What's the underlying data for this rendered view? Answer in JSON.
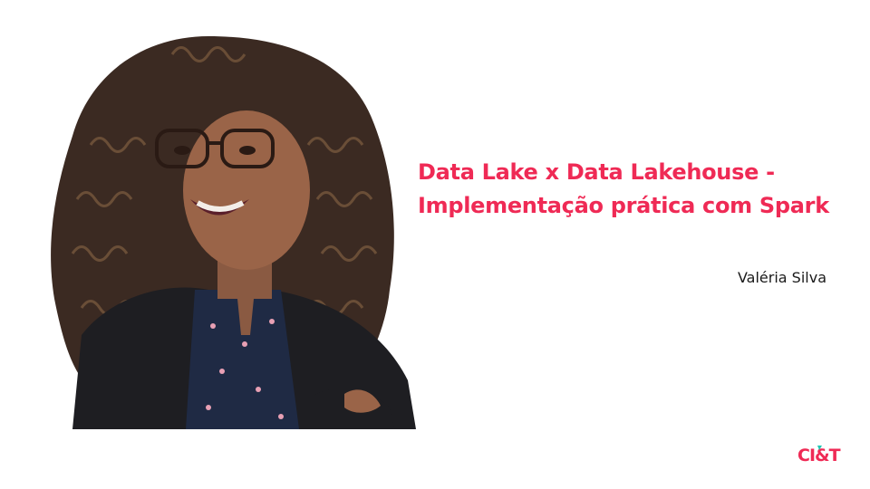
{
  "slide": {
    "title": "Data Lake x Data Lakehouse - Implementação prática com Spark",
    "author": "Valéria Silva",
    "logo": {
      "text": "CI&T",
      "color": "#ef2a55",
      "accent": "#1ec8b4"
    },
    "colors": {
      "title": "#ef2a55",
      "author": "#1a1a1a",
      "background": "#ffffff"
    }
  }
}
